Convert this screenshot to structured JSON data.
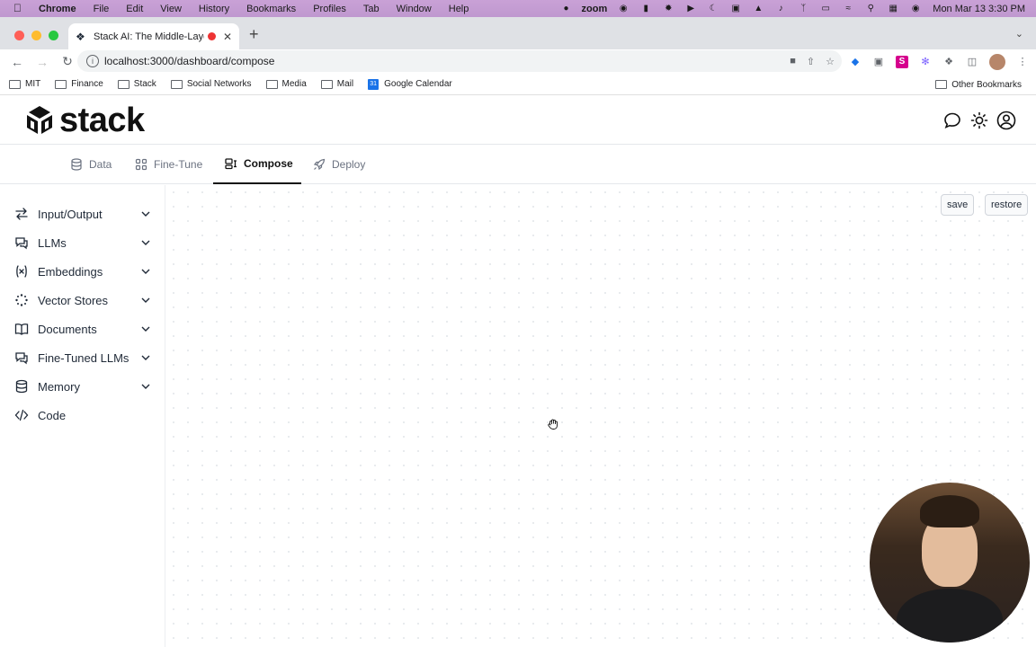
{
  "menubar": {
    "app": "Chrome",
    "menus": [
      "File",
      "Edit",
      "View",
      "History",
      "Bookmarks",
      "Profiles",
      "Tab",
      "Window",
      "Help"
    ],
    "zoom_label": "zoom",
    "clock": "Mon Mar 13  3:30 PM"
  },
  "browser": {
    "tab_title": "Stack AI: The Middle-Layer",
    "url": "localhost:3000/dashboard/compose",
    "bookmarks": [
      "MIT",
      "Finance",
      "Stack",
      "Social Networks",
      "Media",
      "Mail",
      "Google Calendar"
    ],
    "other_bookmarks": "Other Bookmarks"
  },
  "app": {
    "logo_text": "stack",
    "nav_tabs": [
      {
        "label": "Data",
        "icon": "database-icon"
      },
      {
        "label": "Fine-Tune",
        "icon": "grid-icon"
      },
      {
        "label": "Compose",
        "icon": "compose-icon",
        "active": true
      },
      {
        "label": "Deploy",
        "icon": "rocket-icon"
      }
    ],
    "sidebar": [
      {
        "label": "Input/Output",
        "icon": "arrows-icon",
        "expandable": true
      },
      {
        "label": "LLMs",
        "icon": "chat-bubbles-icon",
        "expandable": true
      },
      {
        "label": "Embeddings",
        "icon": "variable-icon",
        "expandable": true
      },
      {
        "label": "Vector Stores",
        "icon": "scatter-icon",
        "expandable": true
      },
      {
        "label": "Documents",
        "icon": "book-icon",
        "expandable": true
      },
      {
        "label": "Fine-Tuned LLMs",
        "icon": "chat-bubbles-icon",
        "expandable": true
      },
      {
        "label": "Memory",
        "icon": "database-icon",
        "expandable": true
      },
      {
        "label": "Code",
        "icon": "code-icon",
        "expandable": false
      }
    ],
    "canvas": {
      "save_label": "save",
      "restore_label": "restore"
    }
  }
}
